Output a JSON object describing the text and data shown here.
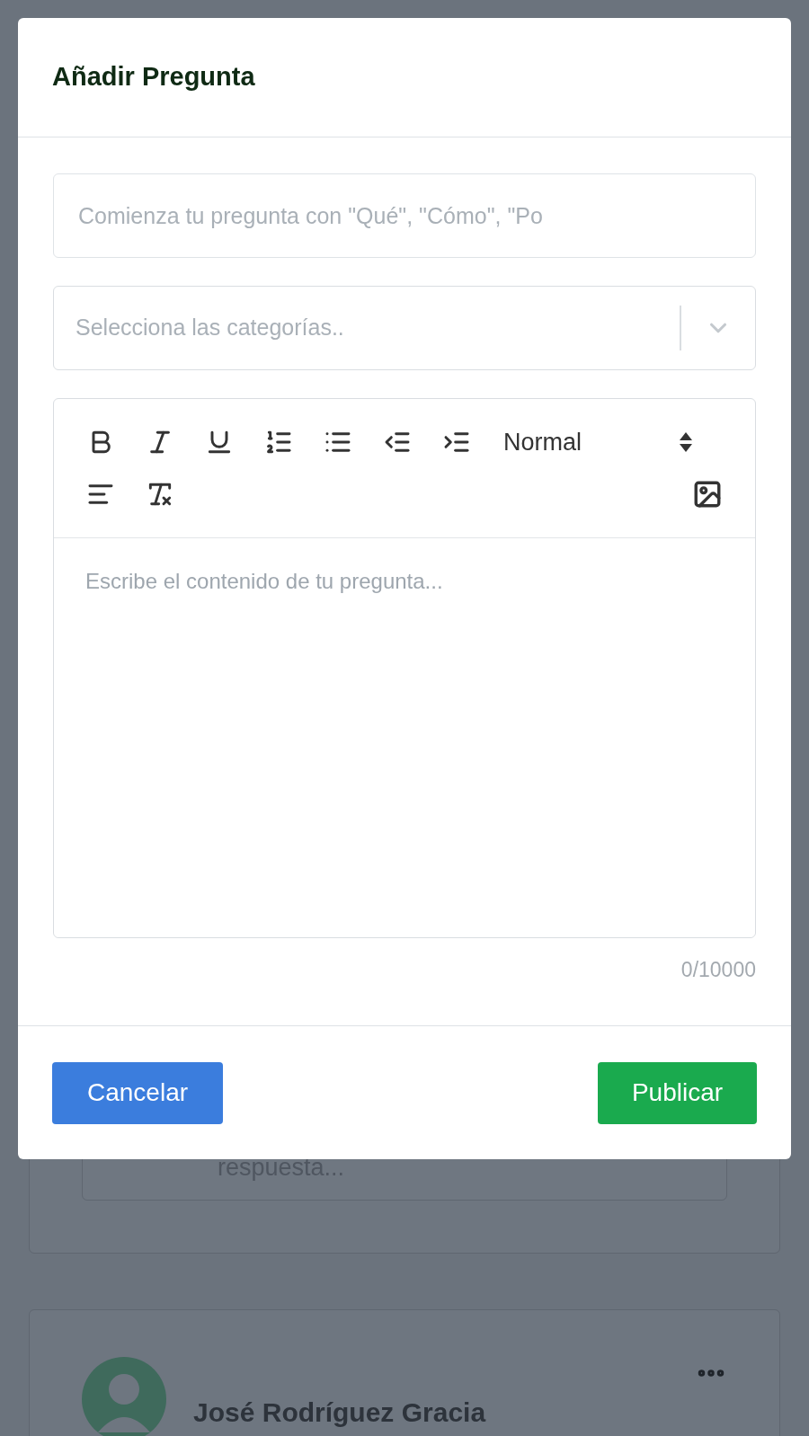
{
  "modal": {
    "title": "Añadir Pregunta",
    "question_field": {
      "placeholder": "Comienza tu pregunta con \"Qué\", \"Cómo\", \"Po"
    },
    "category_select": {
      "placeholder": "Selecciona las categorías.."
    },
    "editor": {
      "heading_select": "Normal",
      "placeholder": "Escribe el contenido de tu pregunta...",
      "counter": "0/10000"
    },
    "buttons": [
      {
        "label": "Cancelar",
        "kind": "secondary"
      },
      {
        "label": "Publicar",
        "kind": "primary"
      }
    ]
  },
  "background": {
    "reply_field": {
      "placeholder": "respuesta..."
    },
    "post": {
      "author": "José Rodríguez Gracia"
    }
  }
}
